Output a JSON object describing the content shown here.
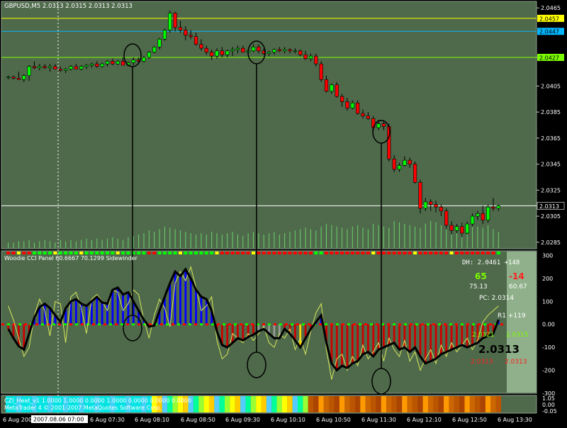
{
  "main_chart": {
    "title": "GBPUSD,M5  2.0313 2.0315 2.0313 2.0313",
    "price_axis": [
      "2.0465",
      "2.0427",
      "2.0405",
      "2.0385",
      "2.0365",
      "2.0345",
      "2.0325",
      "2.0305",
      "2.0285"
    ],
    "level_labels": [
      {
        "text": "2.0457",
        "color": "#ffff00",
        "text_color": "#000000"
      },
      {
        "text": "2.0447",
        "color": "#00b7ff",
        "text_color": "#000000"
      },
      {
        "text": "2.0427",
        "color": "#7cfc00",
        "text_color": "#000000"
      },
      {
        "text": "2.0313",
        "color": "#000000",
        "text_color": "#ffffff"
      }
    ]
  },
  "cci_panel": {
    "title": "Woodie CCI Panel 60.6667 70.1299  Sidewinder",
    "scale": [
      "300",
      "200",
      "100",
      "0.00",
      "-100",
      "-200",
      "-300"
    ],
    "info": {
      "dh": "DH: 2.0461 +148",
      "val_up": "65",
      "val_down": "-14",
      "sub_left": "75.13",
      "sub_right": "60.67",
      "pc": "PC: 2.0314",
      "r1": "R1 +119",
      "green_left": "2.0321",
      "green_right": "2.0315",
      "price_big": "2.0313",
      "red_left": "2.0313",
      "red_right": "2.0313"
    }
  },
  "heat_panel": {
    "line1": "CZI_Heat_v1 1.0000 1.0000 0.0000 1.0000 0.0000 0.0000 0.0000",
    "line2": "MetaTrader 4 © 2001-2007 MetaQuotes Software Corp.",
    "scale": [
      "1.05",
      "0.00",
      "-0.05"
    ]
  },
  "time_axis": [
    "6 Aug 200",
    "2007.08.06 07:00",
    "6 Aug 07:30",
    "6 Aug 08:10",
    "6 Aug 08:50",
    "6 Aug 09:30",
    "6 Aug 10:10",
    "6 Aug 10:50",
    "6 Aug 11:30",
    "6 Aug 12:10",
    "6 Aug 12:50",
    "6 Aug 13:30"
  ],
  "colors": {
    "chart_bg": "#4f6a4b",
    "bull": "#00ff00",
    "bear": "#ff0000",
    "cci_fill_blue": "#0000ff",
    "cci_fill_red": "#cc0000"
  },
  "chart_data": {
    "type": "candlestick",
    "symbol": "GBPUSD",
    "timeframe": "M5",
    "candles": [
      [
        2.0412,
        2.0413,
        2.041,
        2.0412
      ],
      [
        2.0412,
        2.0413,
        2.041,
        2.0411
      ],
      [
        2.0411,
        2.0416,
        2.041,
        2.041
      ],
      [
        2.041,
        2.0414,
        2.0408,
        2.0413
      ],
      [
        2.0413,
        2.0421,
        2.0409,
        2.042
      ],
      [
        2.042,
        2.0424,
        2.0418,
        2.0419
      ],
      [
        2.0419,
        2.0422,
        2.0417,
        2.042
      ],
      [
        2.042,
        2.0422,
        2.0418,
        2.0419
      ],
      [
        2.0419,
        2.0422,
        2.0416,
        2.042
      ],
      [
        2.042,
        2.0422,
        2.0419,
        2.0418
      ],
      [
        2.0418,
        2.042,
        2.0416,
        2.0417
      ],
      [
        2.0417,
        2.0419,
        2.0415,
        2.0418
      ],
      [
        2.0418,
        2.0421,
        2.0417,
        2.042
      ],
      [
        2.042,
        2.0422,
        2.0418,
        2.0418
      ],
      [
        2.0418,
        2.0421,
        2.0417,
        2.042
      ],
      [
        2.042,
        2.0422,
        2.0418,
        2.0421
      ],
      [
        2.0421,
        2.0423,
        2.0419,
        2.0422
      ],
      [
        2.0422,
        2.0424,
        2.0419,
        2.042
      ],
      [
        2.042,
        2.0423,
        2.0419,
        2.0422
      ],
      [
        2.0422,
        2.0425,
        2.042,
        2.0424
      ],
      [
        2.0424,
        2.0426,
        2.0421,
        2.0422
      ],
      [
        2.0422,
        2.0425,
        2.0421,
        2.0424
      ],
      [
        2.0424,
        2.0427,
        2.0421,
        2.0421
      ],
      [
        2.0421,
        2.0424,
        2.042,
        2.0423
      ],
      [
        2.0423,
        2.0427,
        2.0421,
        2.0425
      ],
      [
        2.0425,
        2.0427,
        2.0422,
        2.0424
      ],
      [
        2.0424,
        2.0428,
        2.0423,
        2.0427
      ],
      [
        2.0427,
        2.0432,
        2.0426,
        2.0431
      ],
      [
        2.0431,
        2.0436,
        2.043,
        2.0435
      ],
      [
        2.0435,
        2.0442,
        2.0433,
        2.0441
      ],
      [
        2.0441,
        2.0449,
        2.044,
        2.0448
      ],
      [
        2.0448,
        2.0463,
        2.0446,
        2.0461
      ],
      [
        2.0461,
        2.0462,
        2.0447,
        2.045
      ],
      [
        2.045,
        2.0455,
        2.0446,
        2.0448
      ],
      [
        2.0448,
        2.0451,
        2.044,
        2.0444
      ],
      [
        2.0444,
        2.0448,
        2.0441,
        2.0443
      ],
      [
        2.0443,
        2.0446,
        2.0436,
        2.0437
      ],
      [
        2.0437,
        2.0441,
        2.0432,
        2.0434
      ],
      [
        2.0434,
        2.0436,
        2.0429,
        2.0431
      ],
      [
        2.0431,
        2.0433,
        2.0425,
        2.0428
      ],
      [
        2.0428,
        2.0434,
        2.0426,
        2.0432
      ],
      [
        2.0432,
        2.0435,
        2.0427,
        2.0429
      ],
      [
        2.0429,
        2.0433,
        2.0427,
        2.0432
      ],
      [
        2.0432,
        2.0435,
        2.0428,
        2.0433
      ],
      [
        2.0433,
        2.0436,
        2.043,
        2.0434
      ],
      [
        2.0434,
        2.0436,
        2.0431,
        2.0431
      ],
      [
        2.0431,
        2.0433,
        2.0428,
        2.0432
      ],
      [
        2.0432,
        2.0437,
        2.0431,
        2.0435
      ],
      [
        2.0435,
        2.0437,
        2.043,
        2.0432
      ],
      [
        2.0432,
        2.0434,
        2.0429,
        2.043
      ],
      [
        2.043,
        2.0432,
        2.0428,
        2.0431
      ],
      [
        2.0431,
        2.0434,
        2.0429,
        2.0433
      ],
      [
        2.0433,
        2.0435,
        2.0431,
        2.0432
      ],
      [
        2.0432,
        2.0435,
        2.043,
        2.0433
      ],
      [
        2.0433,
        2.0434,
        2.043,
        2.0432
      ],
      [
        2.0432,
        2.0434,
        2.043,
        2.0432
      ],
      [
        2.0432,
        2.0433,
        2.0428,
        2.0429
      ],
      [
        2.0429,
        2.0432,
        2.0425,
        2.0426
      ],
      [
        2.0426,
        2.043,
        2.0424,
        2.0428
      ],
      [
        2.0428,
        2.043,
        2.042,
        2.0422
      ],
      [
        2.0422,
        2.0424,
        2.0408,
        2.041
      ],
      [
        2.041,
        2.0413,
        2.04,
        2.0401
      ],
      [
        2.0401,
        2.0407,
        2.0399,
        2.0406
      ],
      [
        2.0406,
        2.0408,
        2.0396,
        2.0397
      ],
      [
        2.0397,
        2.0399,
        2.0389,
        2.0393
      ],
      [
        2.0393,
        2.0396,
        2.0386,
        2.0388
      ],
      [
        2.0388,
        2.0394,
        2.0387,
        2.0392
      ],
      [
        2.0392,
        2.0394,
        2.0383,
        2.0384
      ],
      [
        2.0384,
        2.0387,
        2.038,
        2.0382
      ],
      [
        2.0382,
        2.0385,
        2.0379,
        2.038
      ],
      [
        2.038,
        2.0382,
        2.037,
        2.0373
      ],
      [
        2.0373,
        2.0379,
        2.0371,
        2.0376
      ],
      [
        2.0376,
        2.0378,
        2.0371,
        2.0374
      ],
      [
        2.0374,
        2.0376,
        2.0347,
        2.0349
      ],
      [
        2.0349,
        2.0352,
        2.0339,
        2.0341
      ],
      [
        2.0341,
        2.0346,
        2.0339,
        2.0344
      ],
      [
        2.0344,
        2.0351,
        2.0343,
        2.0348
      ],
      [
        2.0348,
        2.035,
        2.0342,
        2.0345
      ],
      [
        2.0345,
        2.0347,
        2.033,
        2.0331
      ],
      [
        2.0331,
        2.0333,
        2.0307,
        2.0311
      ],
      [
        2.0311,
        2.0319,
        2.0309,
        2.0316
      ],
      [
        2.0316,
        2.0318,
        2.0309,
        2.0314
      ],
      [
        2.0314,
        2.0317,
        2.0308,
        2.0312
      ],
      [
        2.0312,
        2.0314,
        2.0305,
        2.0309
      ],
      [
        2.0309,
        2.0311,
        2.0295,
        2.0298
      ],
      [
        2.0298,
        2.0301,
        2.0291,
        2.0294
      ],
      [
        2.0294,
        2.0299,
        2.0292,
        2.0297
      ],
      [
        2.0297,
        2.03,
        2.0289,
        2.0292
      ],
      [
        2.0292,
        2.0301,
        2.0291,
        2.0299
      ],
      [
        2.0299,
        2.0307,
        2.0297,
        2.0305
      ],
      [
        2.0305,
        2.0309,
        2.0302,
        2.0307
      ],
      [
        2.0307,
        2.0313,
        2.0299,
        2.0302
      ],
      [
        2.0302,
        2.0314,
        2.03,
        2.0312
      ],
      [
        2.0312,
        2.0319,
        2.0309,
        2.0311
      ],
      [
        2.0311,
        2.0314,
        2.0309,
        2.0313
      ]
    ],
    "horizontal_levels": [
      2.0457,
      2.0447,
      2.0427,
      2.0313
    ],
    "ylim": [
      2.028,
      2.047
    ],
    "cci": [
      -20,
      -60,
      -95,
      -110,
      -40,
      30,
      75,
      90,
      70,
      40,
      10,
      70,
      100,
      110,
      90,
      80,
      100,
      120,
      95,
      90,
      150,
      160,
      130,
      140,
      100,
      60,
      20,
      -10,
      -5,
      60,
      120,
      180,
      230,
      210,
      240,
      200,
      150,
      120,
      110,
      60,
      -30,
      -90,
      -100,
      -80,
      -60,
      -70,
      -55,
      -45,
      -30,
      -20,
      -40,
      -60,
      -60,
      -20,
      -40,
      -70,
      -100,
      -60,
      -20,
      10,
      40,
      -80,
      -170,
      -200,
      -180,
      -190,
      -170,
      -160,
      -130,
      -120,
      -140,
      -110,
      -100,
      -90,
      -80,
      -110,
      -100,
      -120,
      -100,
      -140,
      -170,
      -160,
      -150,
      -130,
      -120,
      -110,
      -100,
      -90,
      -100,
      -90,
      -80,
      -60,
      -50,
      -40,
      20,
      60,
      70,
      60,
      50
    ],
    "turbo_cci": [
      80,
      20,
      -60,
      -140,
      -100,
      40,
      110,
      60,
      -50,
      100,
      90,
      -80,
      120,
      140,
      70,
      -40,
      110,
      130,
      100,
      60,
      150,
      140,
      60,
      90,
      150,
      130,
      20,
      -60,
      40,
      110,
      70,
      -10,
      180,
      230,
      190,
      250,
      160,
      60,
      80,
      120,
      -70,
      -150,
      -130,
      -40,
      -60,
      -80,
      -40,
      -70,
      -40,
      -10,
      -80,
      -100,
      -40,
      -60,
      -20,
      -110,
      -60,
      -130,
      -30,
      50,
      90,
      -110,
      -240,
      -150,
      -130,
      -200,
      -140,
      -180,
      -90,
      -150,
      -120,
      -80,
      -160,
      -60,
      -110,
      -140,
      -70,
      -160,
      -120,
      -200,
      -150,
      -110,
      -170,
      -90,
      -140,
      -80,
      -120,
      -90,
      -60,
      -110,
      -70,
      10,
      40,
      60,
      80,
      70,
      90,
      110,
      100
    ],
    "cci_ylim": [
      -300,
      320
    ],
    "volume": [
      4,
      4,
      5,
      5,
      6,
      4,
      5,
      6,
      5,
      4,
      6,
      5,
      6,
      5,
      6,
      7,
      6,
      7,
      6,
      7,
      8,
      7,
      6,
      8,
      9,
      10,
      11,
      13,
      12,
      14,
      16,
      15,
      14,
      13,
      12,
      11,
      10,
      11,
      10,
      12,
      11,
      10,
      11,
      12,
      10,
      9,
      11,
      12,
      11,
      10,
      11,
      12,
      10,
      11,
      12,
      13,
      14,
      15,
      14,
      13,
      16,
      18,
      17,
      16,
      15,
      14,
      16,
      17,
      15,
      14,
      18,
      17,
      16,
      15,
      20,
      19,
      18,
      17,
      16,
      15,
      18,
      20,
      19,
      17,
      16,
      14,
      16,
      18,
      19,
      17,
      16,
      15,
      17,
      14,
      12
    ]
  }
}
